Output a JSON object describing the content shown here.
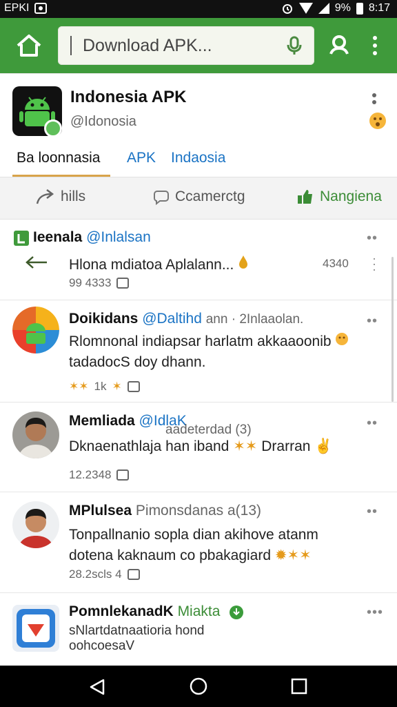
{
  "status_bar": {
    "left_text": "EPKI",
    "battery_pct": "9%",
    "time": "8:17"
  },
  "toolbar": {
    "url_text": "Download APK..."
  },
  "profile": {
    "name": "Indonesia APK",
    "handle": "@Idonosia",
    "tabs": [
      {
        "label": "Ba loonnasia"
      },
      {
        "label": "APK"
      },
      {
        "label": "Indaosia"
      }
    ]
  },
  "actions": [
    {
      "label": "hills",
      "icon": "share-icon"
    },
    {
      "label": "Ccamerctg",
      "icon": "comment-icon"
    },
    {
      "label": "Nangiena",
      "icon": "thumbs-up-icon"
    }
  ],
  "posts": [
    {
      "name": "Ieenala",
      "user": "@Inlalsan",
      "text": "Hlona mdiatoa Aplalann...",
      "side_count": "4340",
      "meta": "99 4333"
    },
    {
      "name": "Doikidans",
      "user": "@Daltihd",
      "extra": "ann · 2Inlaaolan.",
      "line1": "Rlomnonal indiapsar harlatm akkaaoonib",
      "line2": "tadadocS doy dhann.",
      "meta": "1k"
    },
    {
      "name": "Memliada",
      "user": "@IdlaK",
      "extra": "aadeterdad (3)",
      "line1": "Dknaenathlaja han iband",
      "line1_end": "Drarran",
      "meta": "12.2348"
    },
    {
      "name": "MPlulsea",
      "extra": "Pimonsdanas a(13)",
      "line1": "Tonpallnanio sopla dian akihove atanm",
      "line2": "dotena kaknaum co pbakagiard",
      "meta": "28.2scls 4"
    },
    {
      "name": "PomnlekanadK",
      "user": "Miakta",
      "line1": "sNlartdatnaatioria hond",
      "line2": "oohcoesaV"
    }
  ]
}
